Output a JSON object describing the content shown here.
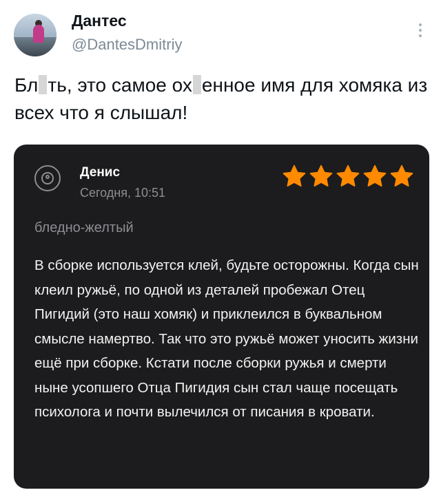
{
  "author": {
    "name": "Дантес",
    "handle": "@DantesDmitriy"
  },
  "tweet": {
    "part1": "Бл",
    "part2": "ть, это самое ох",
    "part3": "енное имя для хомяка из всех что я слышал!"
  },
  "review": {
    "reviewer_name": "Денис",
    "date": "Сегодня, 10:51",
    "rating": 5,
    "variant": "бледно-желтый",
    "text": "В сборке используется клей, будьте осторожны. Когда сын клеил ружьё, по одной из деталей пробежал Отец Пигидий (это наш хомяк) и приклеился в буквальном смысле намертво. Так что это ружьё может уносить жизни ещё при сборке. Кстати после сборки ружья и смерти ныне усопшего Отца Пигидия сын стал чаще посещать психолога и почти вылечился от писания в кровати."
  },
  "colors": {
    "card_bg": "#1c1c1e",
    "star": "#ff8a00",
    "secondary_text": "#8e8e93",
    "handle": "#7d8a96"
  },
  "icons": {
    "more": "more-vertical-icon",
    "user": "user-circle-icon",
    "star": "star-icon"
  }
}
